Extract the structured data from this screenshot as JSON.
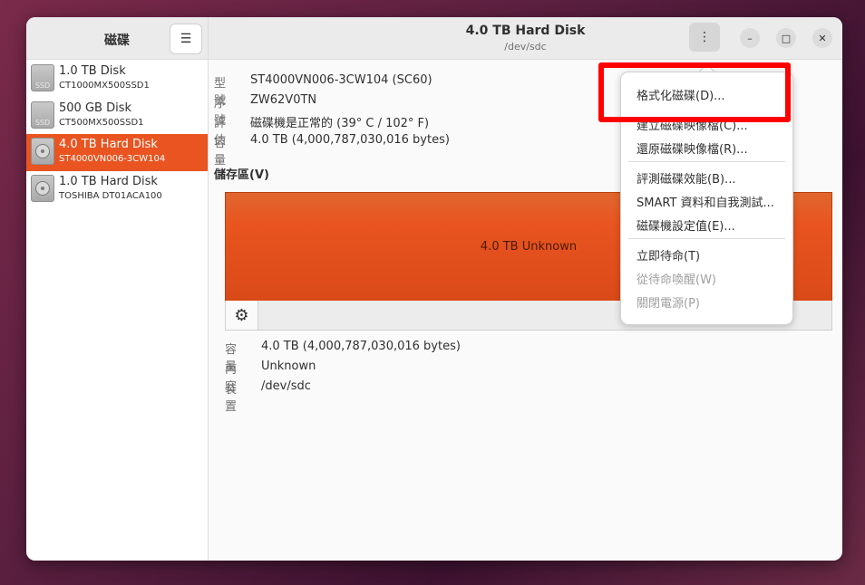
{
  "sidebar": {
    "title": "磁碟",
    "menu_icon": "☰",
    "disks": [
      {
        "name": "1.0 TB Disk",
        "model": "CT1000MX500SSD1",
        "kind": "SSD",
        "icon": "ssd-icon"
      },
      {
        "name": "500 GB Disk",
        "model": "CT500MX500SSD1",
        "kind": "SSD",
        "icon": "ssd-icon"
      },
      {
        "name": "4.0 TB Hard Disk",
        "model": "ST4000VN006-3CW104",
        "kind": "",
        "icon": "hdd-icon",
        "selected": true
      },
      {
        "name": "1.0 TB Hard Disk",
        "model": "TOSHIBA DT01ACA100",
        "kind": "",
        "icon": "hdd-icon"
      }
    ]
  },
  "header": {
    "title": "4.0 TB Hard Disk",
    "subtitle": "/dev/sdc",
    "kebab_icon": "⋮",
    "minimize_icon": "–",
    "maximize_icon": "□",
    "close_icon": "✕"
  },
  "info": {
    "model_key": "型號",
    "model_val": "ST4000VN006-3CW104 (SC60)",
    "serial_key": "序號",
    "serial_val": "ZW62V0TN",
    "assess_key": "評估",
    "assess_val": "磁碟機是正常的 (39° C / 102° F)",
    "size_key": "容量",
    "size_val": "4.0 TB (4,000,787,030,016 bytes)"
  },
  "volumes": {
    "title": "儲存區(V)",
    "partition_label": "4.0 TB Unknown",
    "gear_icon": "⚙"
  },
  "partition_info": {
    "size_key": "容量",
    "size_val": "4.0 TB (4,000,787,030,016 bytes)",
    "content_key": "內容",
    "content_val": "Unknown",
    "device_key": "裝置",
    "device_val": "/dev/sdc"
  },
  "menu": {
    "items": [
      {
        "label": "格式化磁碟(D)...",
        "disabled": false
      },
      {
        "label": "建立磁碟映像檔(C)...",
        "disabled": false
      },
      {
        "label": "還原磁碟映像檔(R)...",
        "disabled": false
      },
      {
        "label": "評測磁碟效能(B)...",
        "disabled": false
      },
      {
        "label": "SMART 資料和自我測試...",
        "disabled": false
      },
      {
        "label": "磁碟機設定值(E)...",
        "disabled": false
      },
      {
        "label": "立即待命(T)",
        "disabled": false
      },
      {
        "label": "從待命喚醒(W)",
        "disabled": true
      },
      {
        "label": "關閉電源(P)",
        "disabled": true
      }
    ]
  },
  "colors": {
    "accent": "#e95420",
    "highlight": "#ff0000"
  }
}
